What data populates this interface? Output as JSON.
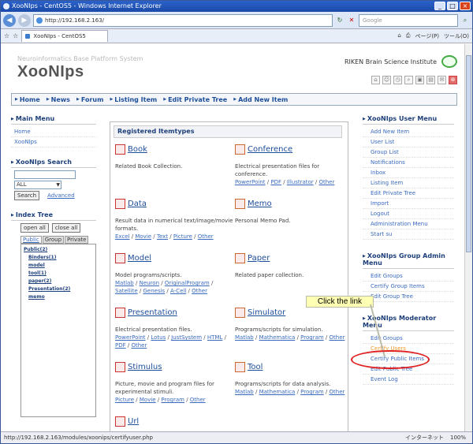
{
  "browser": {
    "window_title": "XooNIps - CentOS5 - Windows Internet Explorer",
    "url": "http://192.168.2.163/",
    "search_placeholder": "Google",
    "tab_label": "XooNIps - CentOS5",
    "tools_page": "ページ(P)",
    "tools_tool": "ツール(O)",
    "status_url": "http://192.168.2.163/modules/xoonips/certifyuser.php",
    "status_zone": "インターネット",
    "status_zoom": "100%"
  },
  "header": {
    "tagline": "Neuroinformatics Base Platform System",
    "logo": "XooNIps",
    "institute": "RIKEN Brain Science Institute"
  },
  "mainnav": [
    "Home",
    "News",
    "Forum",
    "Listing Item",
    "Edit Private Tree",
    "Add New Item"
  ],
  "main_menu": {
    "title": "Main Menu",
    "items": [
      "Home",
      "XooNIps"
    ]
  },
  "search": {
    "title": "XooNIps Search",
    "select_value": "ALL",
    "button": "Search",
    "advanced": "Advanced"
  },
  "index_tree": {
    "title": "Index Tree",
    "open_all": "open all",
    "close_all": "close all",
    "tabs": [
      "Public",
      "Group",
      "Private"
    ],
    "nodes": [
      {
        "label": "Public(2)",
        "level": 0
      },
      {
        "label": "Binders(1)",
        "level": 1
      },
      {
        "label": "model",
        "level": 1
      },
      {
        "label": "tool(1)",
        "level": 1
      },
      {
        "label": "paper(2)",
        "level": 1
      },
      {
        "label": "Presentation(2)",
        "level": 1
      },
      {
        "label": "memo",
        "level": 1
      }
    ]
  },
  "itemtypes": {
    "heading": "Registered Itemtypes",
    "items": [
      {
        "title": "Book",
        "icon": "book-icon",
        "desc": "Related Book Collection.",
        "links": []
      },
      {
        "title": "Conference",
        "icon": "conference-icon",
        "desc": "Electrical presentation files for conference.",
        "links": [
          "PowerPoint",
          "PDF",
          "Illustrator",
          "Other"
        ]
      },
      {
        "title": "Data",
        "icon": "data-icon",
        "desc": "Result data in numerical text/image/movie formats.",
        "links": [
          "Excel",
          "Movie",
          "Text",
          "Picture",
          "Other"
        ]
      },
      {
        "title": "Memo",
        "icon": "memo-icon",
        "desc": "Personal Memo Pad.",
        "links": []
      },
      {
        "title": "Model",
        "icon": "model-icon",
        "desc": "Model programs/scripts.",
        "links": [
          "Matlab",
          "Neuron",
          "OriginalProgram",
          "Satellite",
          "Genesis",
          "A-Cell",
          "Other"
        ]
      },
      {
        "title": "Paper",
        "icon": "paper-icon",
        "desc": "Related paper collection.",
        "links": []
      },
      {
        "title": "Presentation",
        "icon": "presentation-icon",
        "desc": "Electrical presentation files.",
        "links": [
          "PowerPoint",
          "Lotus",
          "JustSystem",
          "HTML",
          "PDF",
          "Other"
        ]
      },
      {
        "title": "Simulator",
        "icon": "simulator-icon",
        "desc": "Programs/scripts for simulation.",
        "links": [
          "Matlab",
          "Mathematica",
          "Program",
          "Other"
        ]
      },
      {
        "title": "Stimulus",
        "icon": "stimulus-icon",
        "desc": "Picture, movie and program files for experimental stimuli.",
        "links": [
          "Picture",
          "Movie",
          "Program",
          "Other"
        ]
      },
      {
        "title": "Tool",
        "icon": "tool-icon",
        "desc": "Programs/scripts for data analysis.",
        "links": [
          "Matlab",
          "Mathematica",
          "Program",
          "Other"
        ]
      },
      {
        "title": "Url",
        "icon": "url-icon",
        "desc": "",
        "links": []
      }
    ]
  },
  "user_menu": {
    "title": "XooNIps User Menu",
    "items": [
      "Add New Item",
      "User List",
      "Group List",
      "Notifications",
      "Inbox",
      "Listing Item",
      "Edit Private Tree",
      "Import",
      "Logout",
      "Administration Menu",
      "Start su"
    ]
  },
  "group_admin_menu": {
    "title": "XooNIps Group Admin Menu",
    "items": [
      "Edit Groups",
      "Certify Group Items",
      "Edit Group Tree"
    ]
  },
  "moderator_menu": {
    "title": "XooNIps Moderator Menu",
    "items": [
      "Edit Groups",
      "Certify Users",
      "Certify Public Items",
      "Edit Public Tree",
      "Event Log"
    ]
  },
  "annotation": {
    "callout": "Click the link",
    "color": "#e02020"
  }
}
